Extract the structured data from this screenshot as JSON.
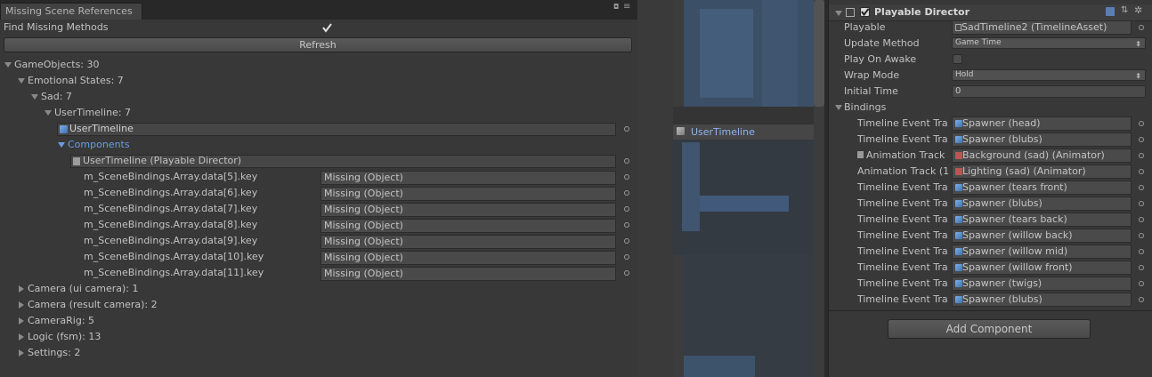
{
  "left": {
    "tab_title": "Missing Scene References",
    "find_missing_label": "Find Missing Methods",
    "find_missing_checked": true,
    "refresh_label": "Refresh",
    "tree": {
      "root": "GameObjects: 30",
      "emotional": "Emotional States: 7",
      "sad": "Sad: 7",
      "user_timeline": "UserTimeline: 7",
      "user_timeline_obj": "UserTimeline",
      "components": "Components",
      "playable_director": "UserTimeline (Playable Director)",
      "bindings": [
        {
          "key": "m_SceneBindings.Array.data[5].key",
          "value": "Missing (Object)"
        },
        {
          "key": "m_SceneBindings.Array.data[6].key",
          "value": "Missing (Object)"
        },
        {
          "key": "m_SceneBindings.Array.data[7].key",
          "value": "Missing (Object)"
        },
        {
          "key": "m_SceneBindings.Array.data[8].key",
          "value": "Missing (Object)"
        },
        {
          "key": "m_SceneBindings.Array.data[9].key",
          "value": "Missing (Object)"
        },
        {
          "key": "m_SceneBindings.Array.data[10].key",
          "value": "Missing (Object)"
        },
        {
          "key": "m_SceneBindings.Array.data[11].key",
          "value": "Missing (Object)"
        }
      ],
      "collapsed": [
        "Camera (ui camera): 1",
        "Camera (result camera): 2",
        "CameraRig: 5",
        "Logic (fsm): 13",
        "Settings: 2"
      ]
    }
  },
  "middle": {
    "hierarchy_item": "UserTimeline"
  },
  "right": {
    "component_title": "Playable Director",
    "enabled": true,
    "playable_label": "Playable",
    "playable_value": "SadTimeline2 (TimelineAsset)",
    "update_method_label": "Update Method",
    "update_method_value": "Game Time",
    "play_on_awake_label": "Play On Awake",
    "play_on_awake_checked": false,
    "wrap_mode_label": "Wrap Mode",
    "wrap_mode_value": "Hold",
    "initial_time_label": "Initial Time",
    "initial_time_value": "0",
    "bindings_label": "Bindings",
    "binding_rows": [
      {
        "label": "Timeline Event Tra",
        "value": "Spawner (head)",
        "icon": "cube-icon"
      },
      {
        "label": "Timeline Event Tra",
        "value": "Spawner (blubs)",
        "icon": "cube-icon"
      },
      {
        "label": "Animation Track",
        "value": "Background (sad) (Animator)",
        "icon": "animator-icon"
      },
      {
        "label": "Animation Track (1",
        "value": "Lighting (sad) (Animator)",
        "icon": "animator-icon"
      },
      {
        "label": "Timeline Event Tra",
        "value": "Spawner (tears front)",
        "icon": "cube-icon"
      },
      {
        "label": "Timeline Event Tra",
        "value": "Spawner (blubs)",
        "icon": "cube-icon"
      },
      {
        "label": "Timeline Event Tra",
        "value": "Spawner (tears back)",
        "icon": "cube-icon"
      },
      {
        "label": "Timeline Event Tra",
        "value": "Spawner (willow back)",
        "icon": "cube-icon"
      },
      {
        "label": "Timeline Event Tra",
        "value": "Spawner (willow mid)",
        "icon": "cube-icon"
      },
      {
        "label": "Timeline Event Tra",
        "value": "Spawner (willow front)",
        "icon": "cube-icon"
      },
      {
        "label": "Timeline Event Tra",
        "value": "Spawner (twigs)",
        "icon": "cube-icon"
      },
      {
        "label": "Timeline Event Tra",
        "value": "Spawner (blubs)",
        "icon": "cube-icon"
      }
    ],
    "add_component_label": "Add Component"
  },
  "colors": {
    "selected_blue": "#6d9de4",
    "panel_bg": "#383838"
  }
}
